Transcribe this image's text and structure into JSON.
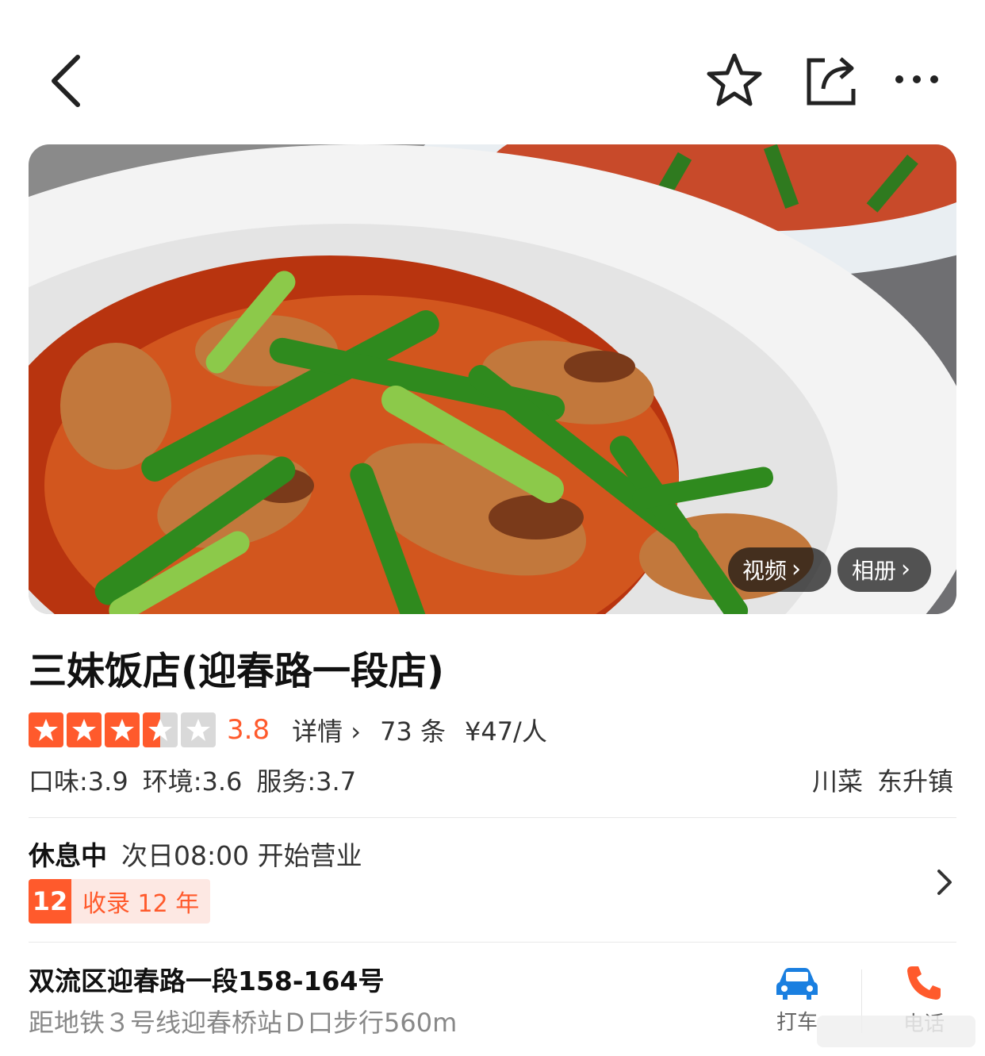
{
  "nav": {
    "back_icon": "chevron-left-icon",
    "favorite_icon": "star-outline-icon",
    "share_icon": "share-icon",
    "more_icon": "more-dots-icon"
  },
  "hero": {
    "video_label": "视频",
    "album_label": "相册"
  },
  "shop": {
    "name": "三妹饭店(迎春路一段店)",
    "rating": 3.8,
    "rating_text": "3.8",
    "detail_label": "详情",
    "review_count": "73 条",
    "price": "¥47/人",
    "scores": {
      "taste": "口味:3.9",
      "environment": "环境:3.6",
      "service": "服务:3.7"
    },
    "category": "川菜",
    "area": "东升镇"
  },
  "hours": {
    "status": "休息中",
    "next_open": "次日08:00 开始营业",
    "badge_number": "12",
    "badge_text": "收录 12 年"
  },
  "location": {
    "address": "双流区迎春路一段158-164号",
    "metro": "距地铁３号线迎春桥站Ｄ口步行560m",
    "taxi_label": "打车",
    "call_label": "电话"
  },
  "colors": {
    "accent": "#ff5a2c",
    "taxi_blue": "#1a7fe0"
  }
}
